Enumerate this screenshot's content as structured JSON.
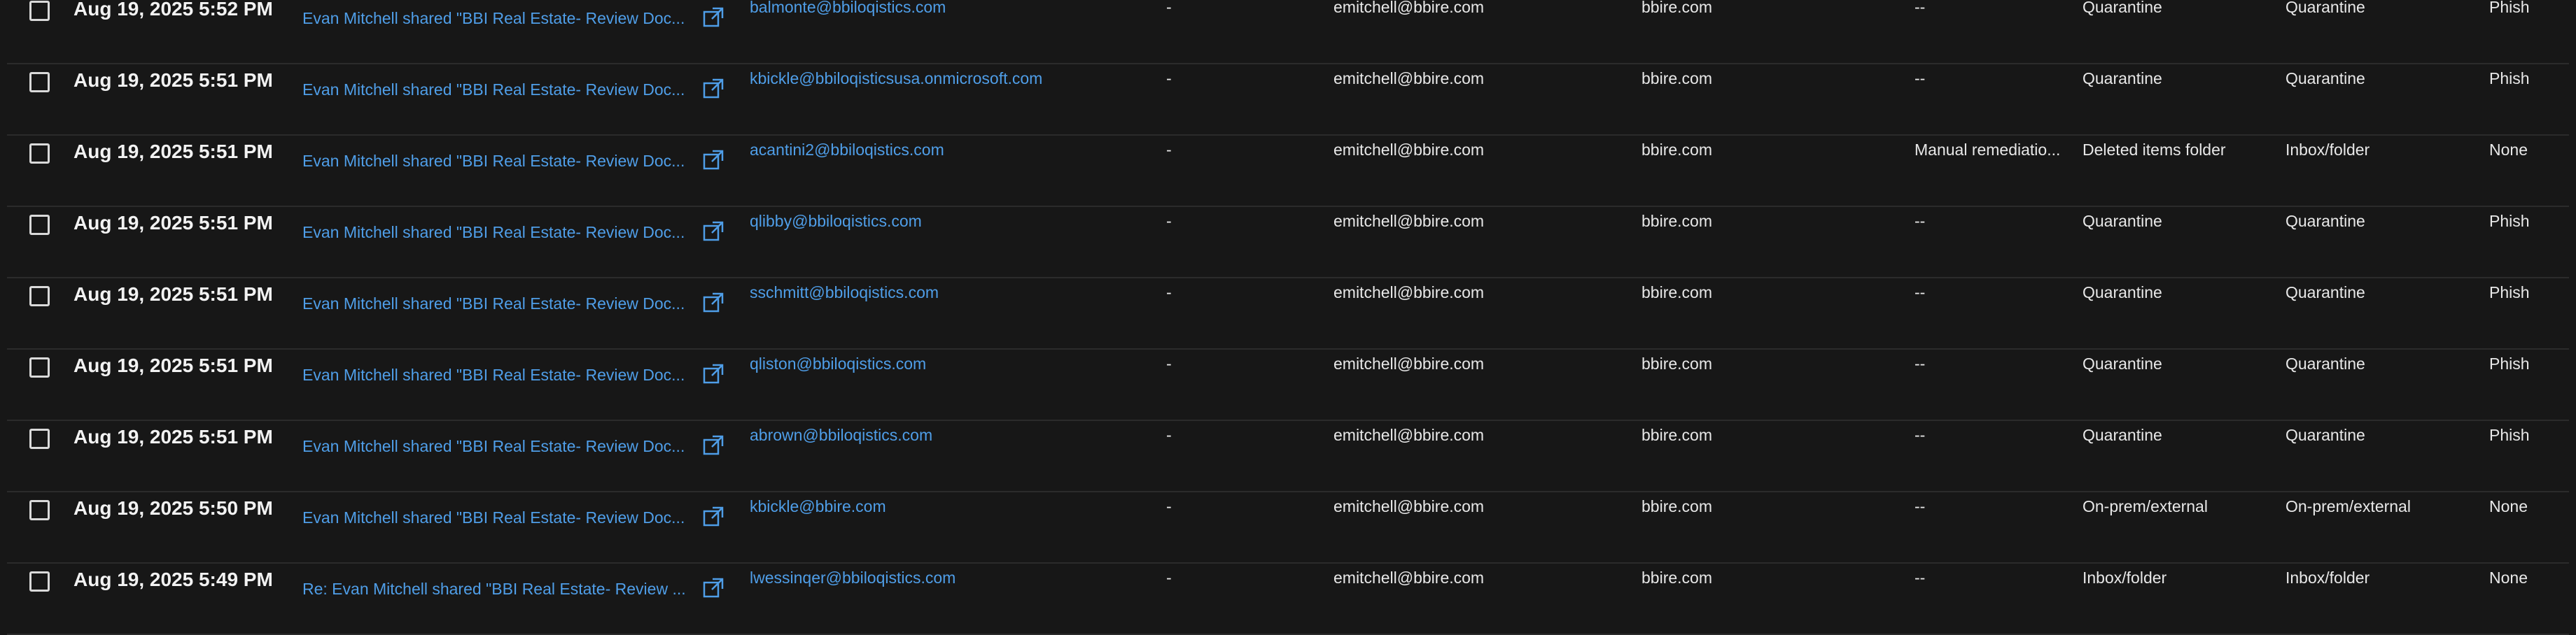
{
  "colors": {
    "background": "#171717",
    "row_divider": "#2b2b2b",
    "link": "#4f9ee8",
    "text": "#e8e8e8"
  },
  "icons": {
    "open": "open-in-new-window-icon"
  },
  "rows": [
    {
      "date": "Aug 19, 2025 5:52 PM",
      "subject": "Evan Mitchell shared \"BBI Real Estate- Review Doc...",
      "recipient": "balmonte@bbiloqistics.com",
      "dash": "-",
      "sender": "emitchell@bbire.com",
      "sender_domain": "bbire.com",
      "remediation": "--",
      "latest_location": "Quarantine",
      "original_location": "Quarantine",
      "threat": "Phish"
    },
    {
      "date": "Aug 19, 2025 5:51 PM",
      "subject": "Evan Mitchell shared \"BBI Real Estate- Review Doc...",
      "recipient": "kbickle@bbiloqisticsusa.onmicrosoft.com",
      "dash": "-",
      "sender": "emitchell@bbire.com",
      "sender_domain": "bbire.com",
      "remediation": "--",
      "latest_location": "Quarantine",
      "original_location": "Quarantine",
      "threat": "Phish"
    },
    {
      "date": "Aug 19, 2025 5:51 PM",
      "subject": "Evan Mitchell shared \"BBI Real Estate- Review Doc...",
      "recipient": "acantini2@bbiloqistics.com",
      "dash": "-",
      "sender": "emitchell@bbire.com",
      "sender_domain": "bbire.com",
      "remediation": "Manual remediatio...",
      "latest_location": "Deleted items folder",
      "original_location": "Inbox/folder",
      "threat": "None"
    },
    {
      "date": "Aug 19, 2025 5:51 PM",
      "subject": "Evan Mitchell shared \"BBI Real Estate- Review Doc...",
      "recipient": "qlibby@bbiloqistics.com",
      "dash": "-",
      "sender": "emitchell@bbire.com",
      "sender_domain": "bbire.com",
      "remediation": "--",
      "latest_location": "Quarantine",
      "original_location": "Quarantine",
      "threat": "Phish"
    },
    {
      "date": "Aug 19, 2025 5:51 PM",
      "subject": "Evan Mitchell shared \"BBI Real Estate- Review Doc...",
      "recipient": "sschmitt@bbiloqistics.com",
      "dash": "-",
      "sender": "emitchell@bbire.com",
      "sender_domain": "bbire.com",
      "remediation": "--",
      "latest_location": "Quarantine",
      "original_location": "Quarantine",
      "threat": "Phish"
    },
    {
      "date": "Aug 19, 2025 5:51 PM",
      "subject": "Evan Mitchell shared \"BBI Real Estate- Review Doc...",
      "recipient": "qliston@bbiloqistics.com",
      "dash": "-",
      "sender": "emitchell@bbire.com",
      "sender_domain": "bbire.com",
      "remediation": "--",
      "latest_location": "Quarantine",
      "original_location": "Quarantine",
      "threat": "Phish"
    },
    {
      "date": "Aug 19, 2025 5:51 PM",
      "subject": "Evan Mitchell shared \"BBI Real Estate- Review Doc...",
      "recipient": "abrown@bbiloqistics.com",
      "dash": "-",
      "sender": "emitchell@bbire.com",
      "sender_domain": "bbire.com",
      "remediation": "--",
      "latest_location": "Quarantine",
      "original_location": "Quarantine",
      "threat": "Phish"
    },
    {
      "date": "Aug 19, 2025 5:50 PM",
      "subject": "Evan Mitchell shared \"BBI Real Estate- Review Doc...",
      "recipient": "kbickle@bbire.com",
      "dash": "-",
      "sender": "emitchell@bbire.com",
      "sender_domain": "bbire.com",
      "remediation": "--",
      "latest_location": "On-prem/external",
      "original_location": "On-prem/external",
      "threat": "None"
    },
    {
      "date": "Aug 19, 2025 5:49 PM",
      "subject": "Re: Evan Mitchell shared \"BBI Real Estate- Review ...",
      "recipient": "lwessinqer@bbiloqistics.com",
      "dash": "-",
      "sender": "emitchell@bbire.com",
      "sender_domain": "bbire.com",
      "remediation": "--",
      "latest_location": "Inbox/folder",
      "original_location": "Inbox/folder",
      "threat": "None"
    }
  ]
}
